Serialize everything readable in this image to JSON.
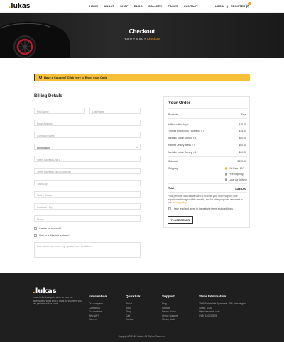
{
  "brand": {
    "logo_dot": ".",
    "logo_name": "lukas"
  },
  "nav": {
    "items": [
      "HOME",
      "ABOUT",
      "SHOP",
      "BLOG",
      "GALLERY",
      "PAGES",
      "CONTACT"
    ]
  },
  "account": {
    "login": "LOGIN",
    "separator": "|",
    "register": "REGISTER",
    "cart_icon": "cart-icon"
  },
  "hero": {
    "title": "Checkout",
    "crumb_home": "Home",
    "crumb_sep1": "»",
    "crumb_shop": "Shop",
    "crumb_sep2": "»",
    "crumb_current": "Checkout"
  },
  "coupon": {
    "text": "Have a Coupon? Click here to Enter your Code"
  },
  "billing": {
    "title": "Billing Details",
    "first_name": "First Name",
    "last_name": "Last Name",
    "email": "Email Address",
    "company": "Company Name",
    "country": "Afghanistan",
    "address1": "Street address Line 1",
    "address2": "Street address Line 2 (Optional)",
    "city": "Town/City",
    "state": "State / Division",
    "postcode": "Postcode / Zip",
    "phone": "Phone",
    "create_account": "Create an account?",
    "ship_different": "Ship to a different address?",
    "notes": "Note about your order, e.g. special notes for delivery"
  },
  "order": {
    "title": "Your Order",
    "head_product": "Products",
    "head_total": "Total",
    "items": [
      {
        "name": "tuffted cotton fay × 1",
        "price": "$35.00"
      },
      {
        "name": "Thread Pink Kindo Fiodya s4 × 1",
        "price": "$35.00"
      },
      {
        "name": "Metallic cotton Jersey × 1",
        "price": "$50.00"
      },
      {
        "name": "Ribbed Jersey dress × 1",
        "price": "$50.00"
      },
      {
        "name": "Metallic cotton Jersey × 1",
        "price": "$60.00"
      }
    ],
    "subtotal_label": "Subtotal",
    "subtotal_value": "$335.00",
    "shipping_label": "Shipping",
    "shipping_options": [
      "Flat Rate : $10",
      "Free Shipping",
      "Local via Delivery"
    ],
    "total_label": "Total",
    "total_value": "$335.00",
    "privacy_text": "Your personal data will be used to process your order, support your experience throughout this website, and for other purposes described in our",
    "privacy_link": "privacy policy.",
    "terms_label": "I have read and agree to the website terms and conditions",
    "place_order": "PLACE ORDER"
  },
  "footer": {
    "logo_dot": ".",
    "logo_name": "lukas",
    "desc": "Lukas is the best parts shop for your car accessories. What kind of parts do you need you can get here soluta nobis",
    "information": {
      "heading": "Information",
      "items": [
        "Our company",
        "Contact us",
        "Our services",
        "Why We?",
        "Careers"
      ]
    },
    "quicklink": {
      "heading": "Quicklink",
      "items": [
        "About",
        "Blog",
        "Shop",
        "Cart",
        "Contact"
      ]
    },
    "support": {
      "heading": "Support",
      "items": [
        "Blog",
        "Contact",
        "Return Policy",
        "Online Support",
        "Money Back"
      ]
    },
    "store": {
      "heading": "Store Information",
      "items": [
        "2005 Stokes Isle Apartment. 896, Washington",
        "10969. USA",
        "https://example.com",
        "(+68) 120034509"
      ]
    },
    "copyright": "Copyright © 2010 Lukas. All Rights Reserved."
  }
}
